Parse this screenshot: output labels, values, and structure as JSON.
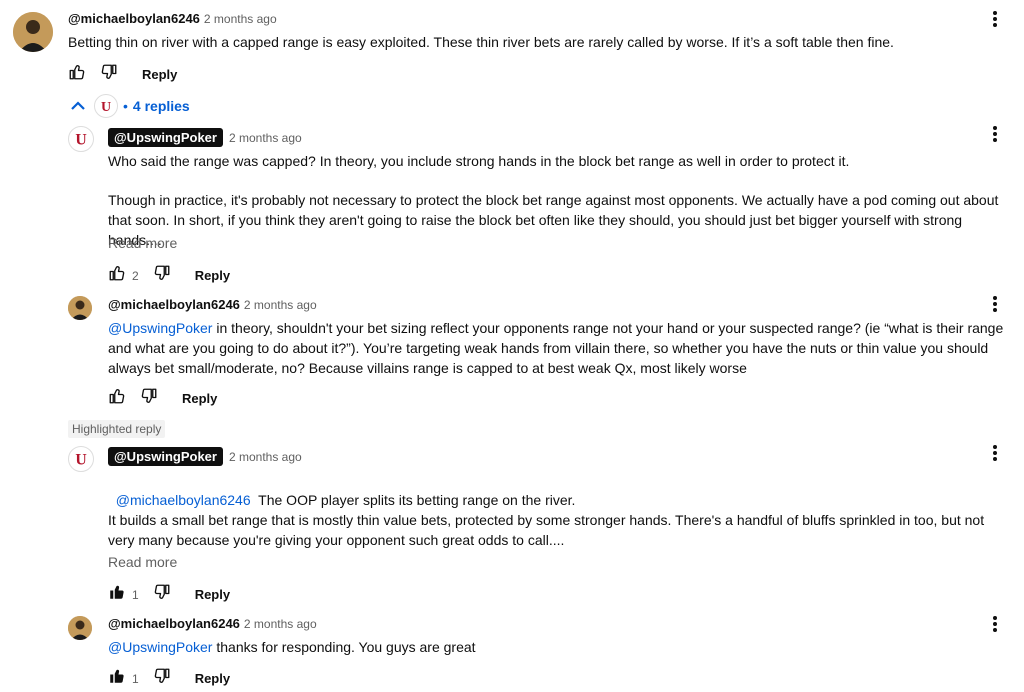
{
  "comments": [
    {
      "handle": "@michaelboylan6246",
      "time": "2 months ago",
      "text": "Betting thin on river with a capped range is easy exploited. These thin river bets are rarely called by worse. If it’s a soft table then fine.",
      "reply_label": "Reply"
    }
  ],
  "thread": {
    "replies_label": "4 replies"
  },
  "replies": [
    {
      "handle": "@UpswingPoker",
      "time": "2 months ago",
      "para1": "Who said the range was capped? In theory, you include strong hands in the block bet range as well in order to protect it.",
      "para2": "Though in practice, it's probably not necessary to protect the block bet range against most opponents. We actually have a pod coming out about that soon. In short, if you think they aren't going to raise the block bet often like they should, you should just bet bigger yourself with strong hands....",
      "read_more": "Read more",
      "likes": "2",
      "reply_label": "Reply"
    },
    {
      "handle": "@michaelboylan6246",
      "time": "2 months ago",
      "mention": "@UpswingPoker",
      "text": " in theory, shouldn't your bet sizing reflect your opponents range not your hand or your suspected range?  (ie “what is their range and what are you going to do about it?”). You’re targeting weak hands from villain there, so whether you have the nuts or thin value you should always bet small/moderate, no? Because villains range is capped to at best weak Qx, most likely worse",
      "reply_label": "Reply"
    },
    {
      "highlight": "Highlighted reply",
      "handle": "@UpswingPoker",
      "time": "2 months ago",
      "mention": "@michaelboylan6246",
      "para1": "  The OOP player splits its betting range on the river.",
      "para2": "It builds a small bet range that is mostly thin value bets, protected by some stronger hands. There's a handful of bluffs sprinkled in too, but not very many because you're giving your opponent such great odds to call....",
      "read_more": "Read more",
      "likes": "1",
      "reply_label": "Reply"
    },
    {
      "handle": "@michaelboylan6246",
      "time": "2 months ago",
      "mention": "@UpswingPoker",
      "text": " thanks for responding. You guys are great",
      "likes": "1",
      "reply_label": "Reply"
    }
  ],
  "colors": {
    "link": "#065fd4",
    "muted": "#606060",
    "text": "#0f0f0f"
  }
}
